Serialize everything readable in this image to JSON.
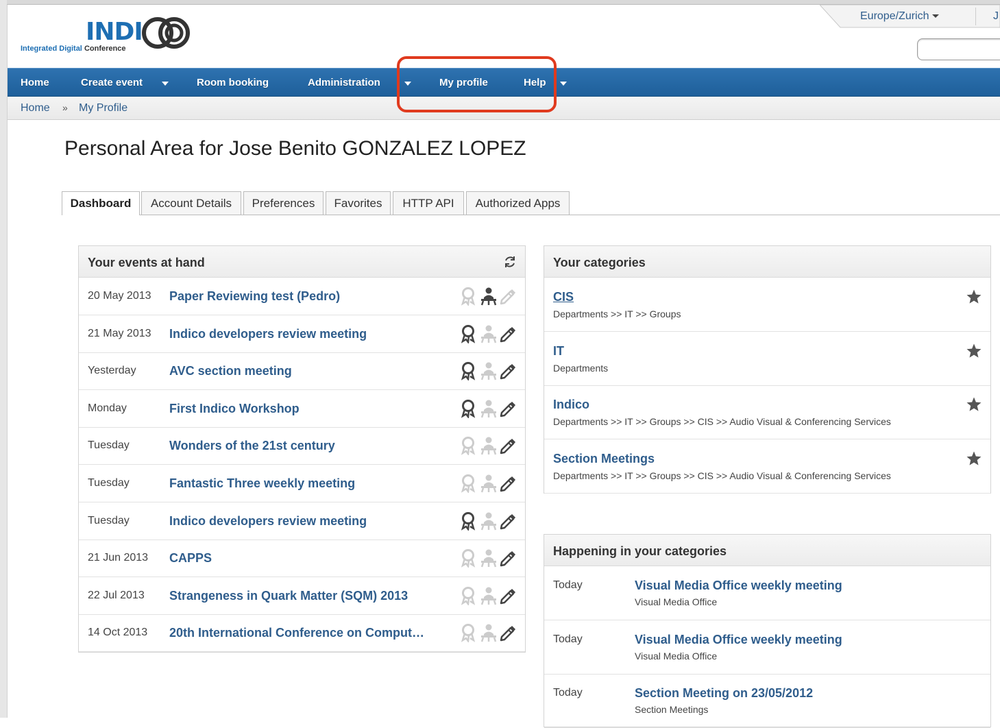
{
  "header": {
    "logo_word": "INDI",
    "logo_tagline": {
      "part1": "Integrated",
      "part2": "Digital",
      "part3": "Conference"
    },
    "timezone": "Europe/Zurich",
    "user_initial": "J",
    "search_value": ""
  },
  "nav": {
    "items": [
      {
        "label": "Home"
      },
      {
        "label": "Create event"
      },
      {
        "label": "Room booking"
      },
      {
        "label": "Administration"
      },
      {
        "label": "My profile"
      },
      {
        "label": "Help"
      }
    ]
  },
  "breadcrumb": {
    "home": "Home",
    "separator": "»",
    "current": "My Profile"
  },
  "page": {
    "title": "Personal Area for Jose Benito GONZALEZ LOPEZ"
  },
  "tabs": [
    {
      "label": "Dashboard"
    },
    {
      "label": "Account Details"
    },
    {
      "label": "Preferences"
    },
    {
      "label": "Favorites"
    },
    {
      "label": "HTTP API"
    },
    {
      "label": "Authorized Apps"
    }
  ],
  "events_panel": {
    "title": "Your events at hand",
    "events": [
      {
        "date": "20 May 2013",
        "title": "Paper Reviewing test (Pedro)",
        "icons": [
          "inactive",
          "active",
          "inactive"
        ]
      },
      {
        "date": "21 May 2013",
        "title": "Indico developers review meeting",
        "icons": [
          "active",
          "inactive",
          "active"
        ]
      },
      {
        "date": "Yesterday",
        "title": "AVC section meeting",
        "icons": [
          "active",
          "inactive",
          "active"
        ]
      },
      {
        "date": "Monday",
        "title": "First Indico Workshop",
        "icons": [
          "active",
          "inactive",
          "active"
        ]
      },
      {
        "date": "Tuesday",
        "title": "Wonders of the 21st century",
        "icons": [
          "inactive",
          "inactive",
          "active"
        ]
      },
      {
        "date": "Tuesday",
        "title": "Fantastic Three weekly meeting",
        "icons": [
          "inactive",
          "inactive",
          "active"
        ]
      },
      {
        "date": "Tuesday",
        "title": "Indico developers review meeting",
        "icons": [
          "active",
          "inactive",
          "active"
        ]
      },
      {
        "date": "21 Jun 2013",
        "title": "CAPPS",
        "icons": [
          "inactive",
          "inactive",
          "active"
        ]
      },
      {
        "date": "22 Jul 2013",
        "title": "Strangeness in Quark Matter (SQM) 2013",
        "icons": [
          "inactive",
          "inactive",
          "active"
        ]
      },
      {
        "date": "14 Oct 2013",
        "title": "20th International Conference on Comput…",
        "icons": [
          "inactive",
          "inactive",
          "active"
        ]
      }
    ]
  },
  "categories_panel": {
    "title": "Your categories",
    "categories": [
      {
        "name": "CIS",
        "path": "Departments >> IT >> Groups"
      },
      {
        "name": "IT",
        "path": "Departments"
      },
      {
        "name": "Indico",
        "path": "Departments >> IT >> Groups >> CIS >> Audio Visual & Conferencing Services"
      },
      {
        "name": "Section Meetings",
        "path": "Departments >> IT >> Groups >> CIS >> Audio Visual & Conferencing Services"
      }
    ]
  },
  "happening_panel": {
    "title": "Happening in your categories",
    "items": [
      {
        "when": "Today",
        "title": "Visual Media Office weekly meeting",
        "category": "Visual Media Office"
      },
      {
        "when": "Today",
        "title": "Visual Media Office weekly meeting",
        "category": "Visual Media Office"
      },
      {
        "when": "Today",
        "title": "Section Meeting on 23/05/2012",
        "category": "Section Meetings"
      }
    ]
  },
  "colors": {
    "nav_blue": "#1e5f9a",
    "link_blue": "#2f5d8c",
    "highlight_red": "#e03a1e",
    "icon_active": "#444444",
    "icon_inactive": "#cccccc"
  }
}
